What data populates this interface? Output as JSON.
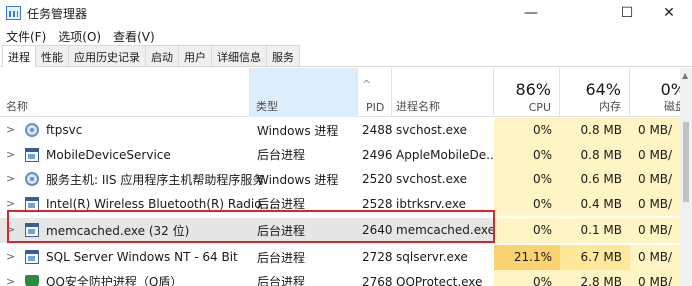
{
  "window": {
    "title": "任务管理器",
    "minimize": "—",
    "maximize": "☐",
    "close": "✕"
  },
  "menu": [
    "文件(F)",
    "选项(O)",
    "查看(V)"
  ],
  "tabs": [
    "进程",
    "性能",
    "应用历史记录",
    "启动",
    "用户",
    "详细信息",
    "服务"
  ],
  "header": {
    "name": "名称",
    "type": "类型",
    "pid": "PID",
    "procname": "进程名称",
    "cpu_label": "CPU",
    "cpu_pct": "86%",
    "mem_label": "内存",
    "mem_pct": "64%",
    "disk_label": "磁盘",
    "disk_pct": "0%",
    "sort_indicator": "^"
  },
  "rows": [
    {
      "name": "ftpsvc",
      "type": "Windows 进程",
      "pid": "2488",
      "procname": "svchost.exe",
      "cpu": "0%",
      "mem": "0.8 MB",
      "disk": "0 MB/",
      "icon": "gear-icon"
    },
    {
      "name": "MobileDeviceService",
      "type": "后台进程",
      "pid": "2496",
      "procname": "AppleMobileDe...",
      "cpu": "0%",
      "mem": "0.8 MB",
      "disk": "0 MB/",
      "icon": "window-icon"
    },
    {
      "name": "服务主机: IIS 应用程序主机帮助程序服务",
      "type": "Windows 进程",
      "pid": "2520",
      "procname": "svchost.exe",
      "cpu": "0%",
      "mem": "0.6 MB",
      "disk": "0 MB/",
      "icon": "gear-icon"
    },
    {
      "name": "Intel(R) Wireless Bluetooth(R) Radio ...",
      "type": "后台进程",
      "pid": "2528",
      "procname": "ibtrksrv.exe",
      "cpu": "0%",
      "mem": "0.4 MB",
      "disk": "0 MB/",
      "icon": "window-icon"
    },
    {
      "name": "memcached.exe (32 位)",
      "type": "后台进程",
      "pid": "2640",
      "procname": "memcached.exe",
      "cpu": "0%",
      "mem": "0.1 MB",
      "disk": "0 MB/",
      "icon": "window-icon"
    },
    {
      "name": "SQL Server Windows NT - 64 Bit",
      "type": "后台进程",
      "pid": "2728",
      "procname": "sqlservr.exe",
      "cpu": "21.1%",
      "mem": "6.7 MB",
      "disk": "0 MB/",
      "icon": "window-icon"
    },
    {
      "name": "QQ安全防护进程（Q盾）",
      "type": "后台进程",
      "pid": "2768",
      "procname": "QQProtect.exe",
      "cpu": "0%",
      "mem": "2.8 MB",
      "disk": "0 MB/",
      "icon": "shield-icon"
    }
  ]
}
